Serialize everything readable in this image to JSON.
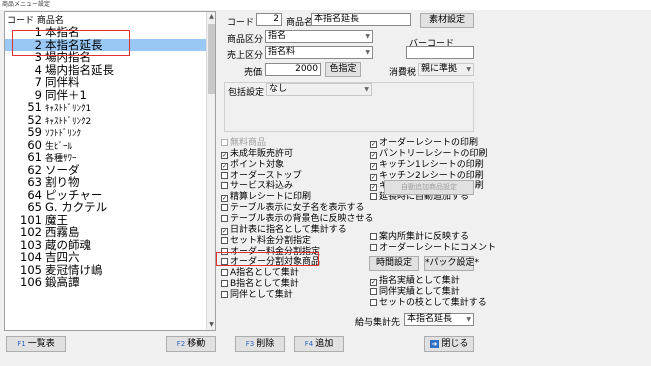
{
  "window": {
    "title": "商品メニュー設定"
  },
  "list": {
    "header_code": "コード",
    "header_name": "商品名",
    "rows": [
      {
        "code": "1",
        "name": "本指名"
      },
      {
        "code": "2",
        "name": "本指名延長"
      },
      {
        "code": "3",
        "name": "場内指名"
      },
      {
        "code": "4",
        "name": "場内指名延長"
      },
      {
        "code": "7",
        "name": "同伴料"
      },
      {
        "code": "9",
        "name": "同伴＋1"
      },
      {
        "code": "51",
        "name": "ｷｬｽﾄﾄﾞﾘﾝｸ1"
      },
      {
        "code": "52",
        "name": "ｷｬｽﾄﾄﾞﾘﾝｸ2"
      },
      {
        "code": "59",
        "name": "ｿﾌﾄﾄﾞﾘﾝｸ"
      },
      {
        "code": "60",
        "name": "生ﾋﾞｰﾙ"
      },
      {
        "code": "61",
        "name": "各種ｻﾜｰ"
      },
      {
        "code": "62",
        "name": "ソーダ"
      },
      {
        "code": "63",
        "name": "割り物"
      },
      {
        "code": "64",
        "name": "ピッチャー"
      },
      {
        "code": "65",
        "name": "G. カクテル"
      },
      {
        "code": "101",
        "name": "魔王"
      },
      {
        "code": "102",
        "name": "西霧島"
      },
      {
        "code": "103",
        "name": "蔵の師魂"
      },
      {
        "code": "104",
        "name": "吉四六"
      },
      {
        "code": "105",
        "name": "麦冠情け嶋"
      },
      {
        "code": "106",
        "name": "鍛高譚"
      }
    ],
    "selected_index": 1
  },
  "form": {
    "code_label": "コード",
    "code_value": "2",
    "name_label": "商品名",
    "name_value": "本指名延長",
    "material_button": "素材設定",
    "category_label": "商品区分",
    "category_value": "指名",
    "sales_label": "売上区分",
    "sales_value": "指名料",
    "barcode_label": "バーコード",
    "barcode_value": "",
    "price_label": "売価",
    "price_value": "2000",
    "color_button": "色指定",
    "tax_label": "消費税",
    "tax_value": "親に準拠",
    "package_label": "包括設定",
    "package_value": "なし"
  },
  "options_left": [
    {
      "label": "無料商品",
      "checked": false,
      "disabled": true
    },
    {
      "label": "未成年販売許可",
      "checked": true,
      "disabled": false
    },
    {
      "label": "ポイント対象",
      "checked": true,
      "disabled": false
    },
    {
      "label": "オーダーストップ",
      "checked": false,
      "disabled": false
    },
    {
      "label": "サービス料込み",
      "checked": false,
      "disabled": false
    },
    {
      "label": "精算レシートに印刷",
      "checked": true,
      "disabled": false
    },
    {
      "label": "テーブル表示に女子名を表示する",
      "checked": false,
      "disabled": false
    },
    {
      "label": "テーブル表示の背景色に反映させる",
      "checked": false,
      "disabled": false
    },
    {
      "label": "日計表に指名として集計する",
      "checked": true,
      "disabled": false
    },
    {
      "label": "セット料金分割指定",
      "checked": false,
      "disabled": false
    },
    {
      "label": "オーダー料金分割指定",
      "checked": false,
      "disabled": false
    },
    {
      "label": "オーダー分割対象商品",
      "checked": false,
      "disabled": false
    },
    {
      "label": "A指名として集計",
      "checked": false,
      "disabled": false
    },
    {
      "label": "B指名として集計",
      "checked": false,
      "disabled": false
    },
    {
      "label": "同伴として集計",
      "checked": false,
      "disabled": false
    }
  ],
  "options_right": [
    {
      "label": "オーダーレシートの印刷",
      "checked": true,
      "disabled": false
    },
    {
      "label": "パントリーレシートの印刷",
      "checked": true,
      "disabled": false
    },
    {
      "label": "キッチン1レシートの印刷",
      "checked": true,
      "disabled": false
    },
    {
      "label": "キッチン2レシートの印刷",
      "checked": true,
      "disabled": false
    },
    {
      "label": "キッチン3レシートの印刷",
      "checked": true,
      "disabled": false
    },
    {
      "label": "延長時に自動追加する",
      "checked": false,
      "disabled": false
    }
  ],
  "auto_add_button": "自動追加商品設定",
  "options_right2": [
    {
      "label": "案内所集計に反映する",
      "checked": false,
      "disabled": false
    },
    {
      "label": "オーダーレシートにコメント",
      "checked": false,
      "disabled": false
    }
  ],
  "time_button": "時間設定",
  "pack_button": "*パック設定*",
  "options_right3": [
    {
      "label": "指名実績として集計",
      "checked": true,
      "disabled": false
    },
    {
      "label": "同伴実績として集計",
      "checked": false,
      "disabled": false
    },
    {
      "label": "セットの枝として集計する",
      "checked": false,
      "disabled": false
    }
  ],
  "salary_label": "給与集計先",
  "salary_value": "本指名延長",
  "bottom": {
    "list_button": "一覧表",
    "list_key": "F1",
    "move_button": "移動",
    "move_key": "F2",
    "delete_button": "削除",
    "delete_key": "F3",
    "add_button": "追加",
    "add_key": "F4",
    "close_button": "閉じる"
  },
  "colors": {
    "selected_row": "#99c8f5",
    "highlight_box": "#e03030"
  }
}
